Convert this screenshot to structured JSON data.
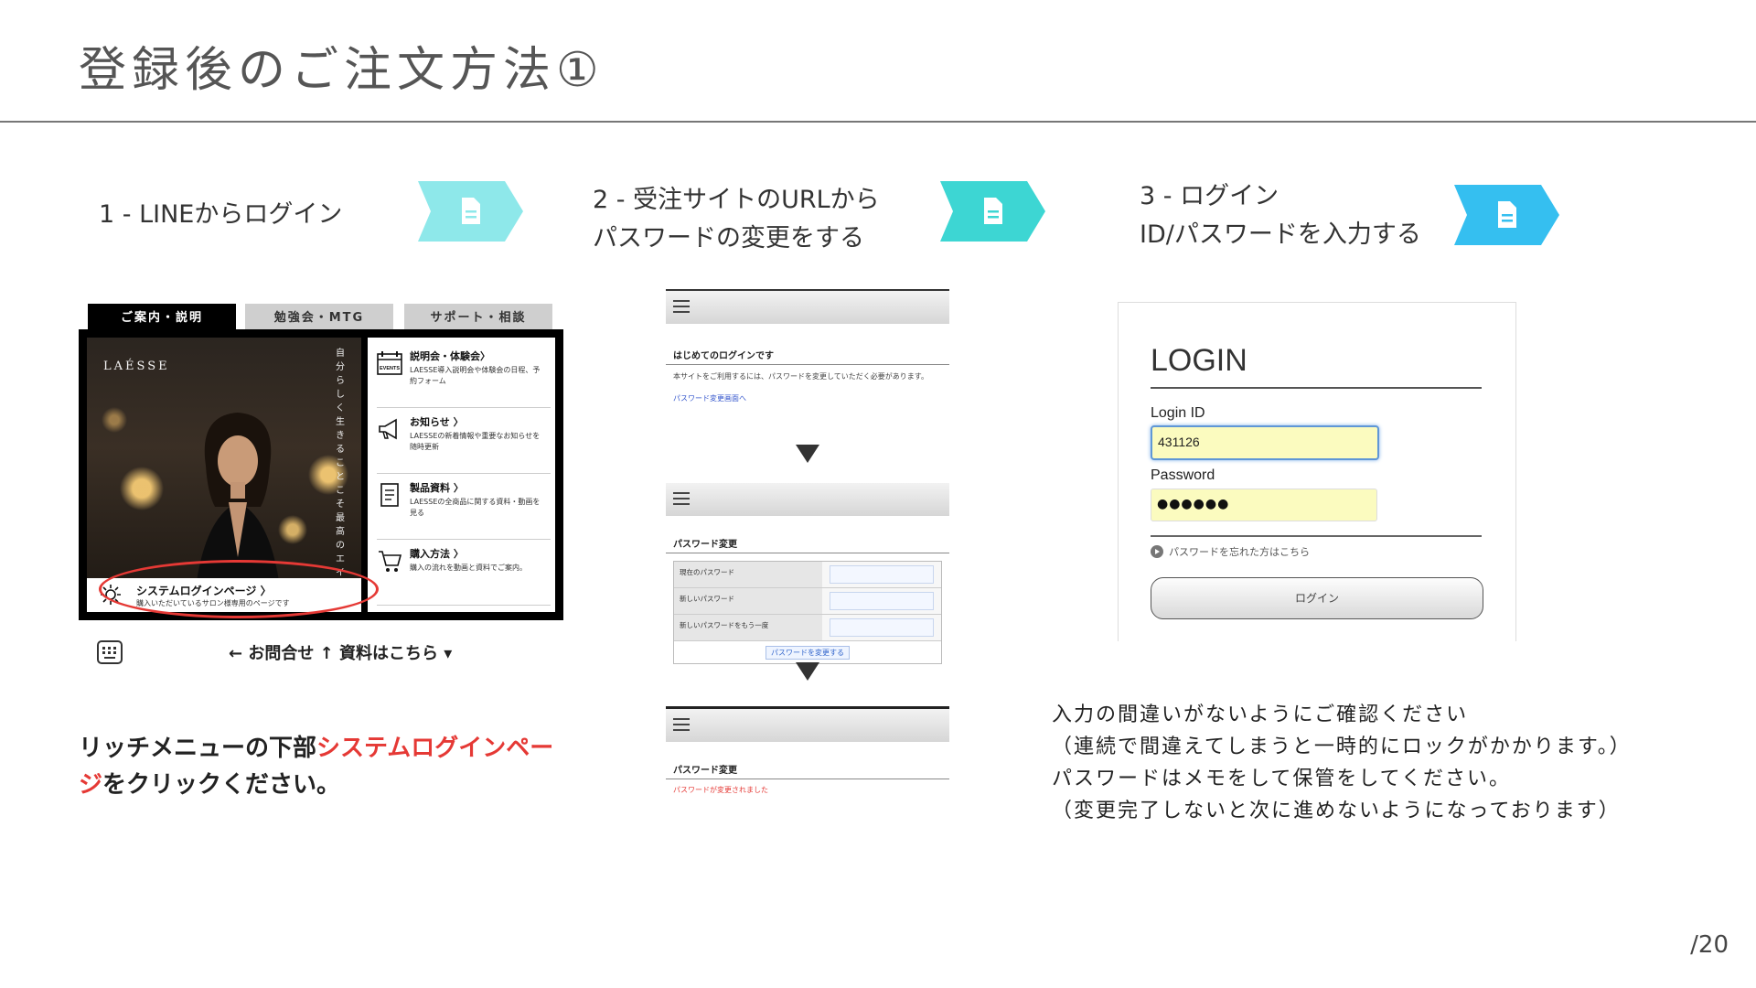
{
  "slide": {
    "title": "登録後のご注文方法①",
    "page_number": "/20"
  },
  "steps": [
    {
      "label_line1": "1 - LINEからログイン",
      "label_line2": "",
      "chevron_color": "#8ee8ea",
      "icon": "document-icon"
    },
    {
      "label_line1": "2 - 受注サイトのURLから",
      "label_line2": "パスワードの変更をする",
      "chevron_color": "#3dd6d3",
      "icon": "document-icon"
    },
    {
      "label_line1": "3 - ログイン",
      "label_line2": "ID/パスワードを入力する",
      "chevron_color": "#35bff0",
      "icon": "document-icon"
    }
  ],
  "line_menu": {
    "tabs": [
      "ご案内・説明",
      "勉強会・MTG",
      "サポート・相談"
    ],
    "brand": "LAÉSSE",
    "vertical_text": "自分らしく生きることこそ最高のエイジングケア。",
    "items": [
      {
        "title": "説明会・体験会〉",
        "desc": "LAESSE導入説明会や体験会の日程、予約フォーム",
        "icon": "events-calendar-icon",
        "icon_text": "EVENTS"
      },
      {
        "title": "お知らせ 〉",
        "desc": "LAESSEの新着情報や重要なお知らせを随時更新",
        "icon": "megaphone-icon"
      },
      {
        "title": "製品資料 〉",
        "desc": "LAESSEの全商品に関する資料・動画を見る",
        "icon": "document-icon"
      },
      {
        "title": "購入方法 〉",
        "desc": "購入の流れを動画と資料でご案内。",
        "icon": "cart-icon"
      }
    ],
    "system_login": {
      "title": "システムログインページ 〉",
      "desc": "購入いただいているサロン様専用のページです",
      "icon": "gear-icon"
    },
    "footer": {
      "keyboard_icon": "keyboard-icon",
      "text": "← お問合せ ↑ 資料はこちら ▾"
    }
  },
  "caption1": {
    "prefix": "リッチメニューの下部",
    "highlight": "システムログインペー",
    "highlight2": "ジ",
    "suffix": "をクリックください。",
    "highlight_color": "#e53935"
  },
  "password_flow": {
    "panel1": {
      "section": "はじめてのログインです",
      "text": "本サイトをご利用するには、パスワードを変更していただく必要があります。",
      "link": "パスワード変更画面へ"
    },
    "panel2": {
      "section": "パスワード変更",
      "rows": [
        "現在のパスワード",
        "新しいパスワード",
        "新しいパスワードをもう一度"
      ],
      "button": "パスワードを変更する"
    },
    "panel3": {
      "section": "パスワード変更",
      "message": "パスワードが変更されました"
    }
  },
  "login": {
    "heading": "LOGIN",
    "id_label": "Login ID",
    "id_value": "431126",
    "password_label": "Password",
    "password_value": "●●●●●●",
    "forgot_link": "パスワードを忘れた方はこちら",
    "button": "ログイン"
  },
  "note": {
    "line1": "入力の間違いがないようにご確認ください",
    "line2": "（連続で間違えてしまうと一時的にロックがかかります。）",
    "line3": "パスワードはメモをして保管をしてください。",
    "line4": "（変更完了しないと次に進めないようになっております）"
  }
}
